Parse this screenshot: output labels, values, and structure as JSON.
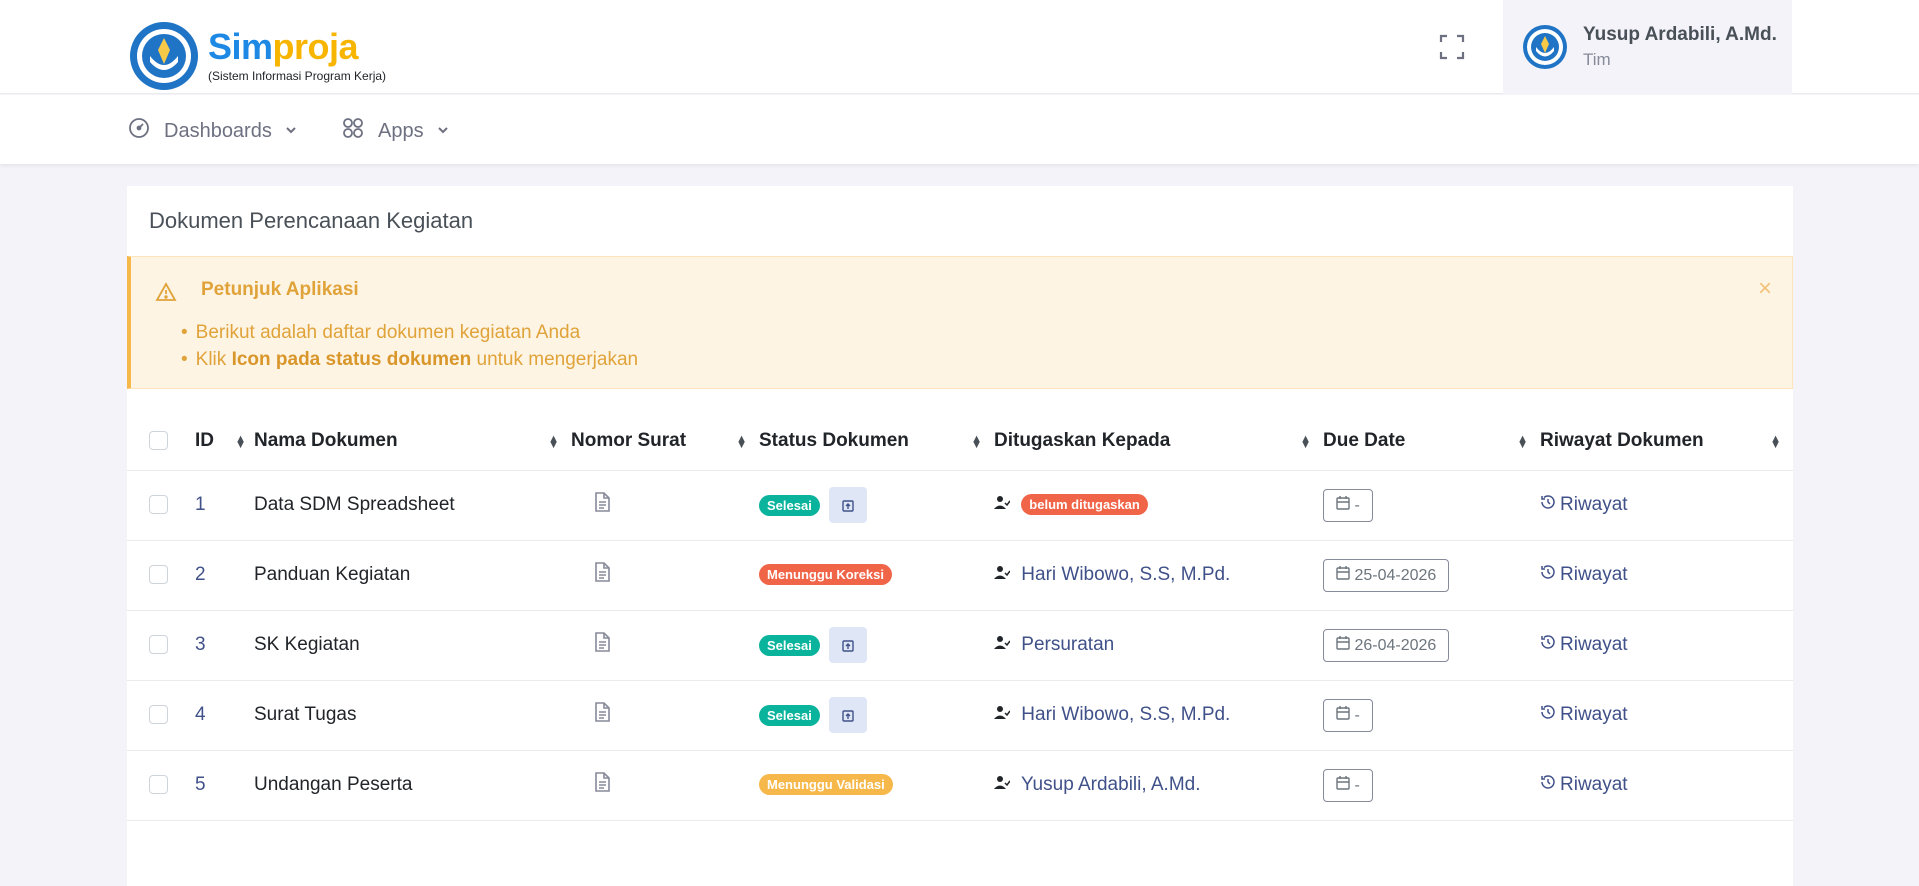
{
  "header": {
    "logo_primary": "Sim",
    "logo_secondary": "proja",
    "logo_subtitle": "(Sistem Informasi Program Kerja)",
    "user_name": "Yusup Ardabili, A.Md.",
    "user_role": "Tim"
  },
  "nav": {
    "dashboards": "Dashboards",
    "apps": "Apps"
  },
  "card": {
    "title": "Dokumen Perencanaan Kegiatan"
  },
  "alert": {
    "title": "Petunjuk Aplikasi",
    "line1": "Berikut adalah daftar dokumen kegiatan Anda",
    "line2_prefix": "Klik ",
    "line2_bold": "Icon pada status dokumen",
    "line2_suffix": " untuk mengerjakan",
    "close": "×"
  },
  "table": {
    "columns": [
      "ID",
      "Nama Dokumen",
      "Nomor Surat",
      "Status Dokumen",
      "Ditugaskan Kepada",
      "Due Date",
      "Riwayat Dokumen"
    ],
    "rows": [
      {
        "id": "1",
        "name": "Data SDM Spreadsheet",
        "status": "Selesai",
        "assignee": "belum ditugaskan",
        "due": "-",
        "history": "Riwayat"
      },
      {
        "id": "2",
        "name": "Panduan Kegiatan",
        "status": "Menunggu Koreksi",
        "assignee": "Hari Wibowo, S.S, M.Pd.",
        "due": "25-04-2026",
        "history": "Riwayat"
      },
      {
        "id": "3",
        "name": "SK Kegiatan",
        "status": "Selesai",
        "assignee": "Persuratan",
        "due": "26-04-2026",
        "history": "Riwayat"
      },
      {
        "id": "4",
        "name": "Surat Tugas",
        "status": "Selesai",
        "assignee": "Hari Wibowo, S.S, M.Pd.",
        "due": "-",
        "history": "Riwayat"
      },
      {
        "id": "5",
        "name": "Undangan Peserta",
        "status": "Menunggu Validasi",
        "assignee": "Yusup Ardabili, A.Md.",
        "due": "-",
        "history": "Riwayat"
      }
    ]
  },
  "colors": {
    "brand_blue": "#1e88e5",
    "brand_yellow": "#f7b500",
    "success": "#0ab39c",
    "danger": "#f06548",
    "warning": "#f7b84b",
    "link": "#405189"
  },
  "icons": {
    "fullscreen": "fullscreen-icon",
    "dashboard": "speedometer-icon",
    "apps": "grid-icon",
    "alert": "warning-triangle-icon",
    "document": "file-document-icon",
    "upload": "upload-icon",
    "user": "user-assign-icon",
    "calendar": "calendar-icon",
    "history": "history-icon"
  }
}
